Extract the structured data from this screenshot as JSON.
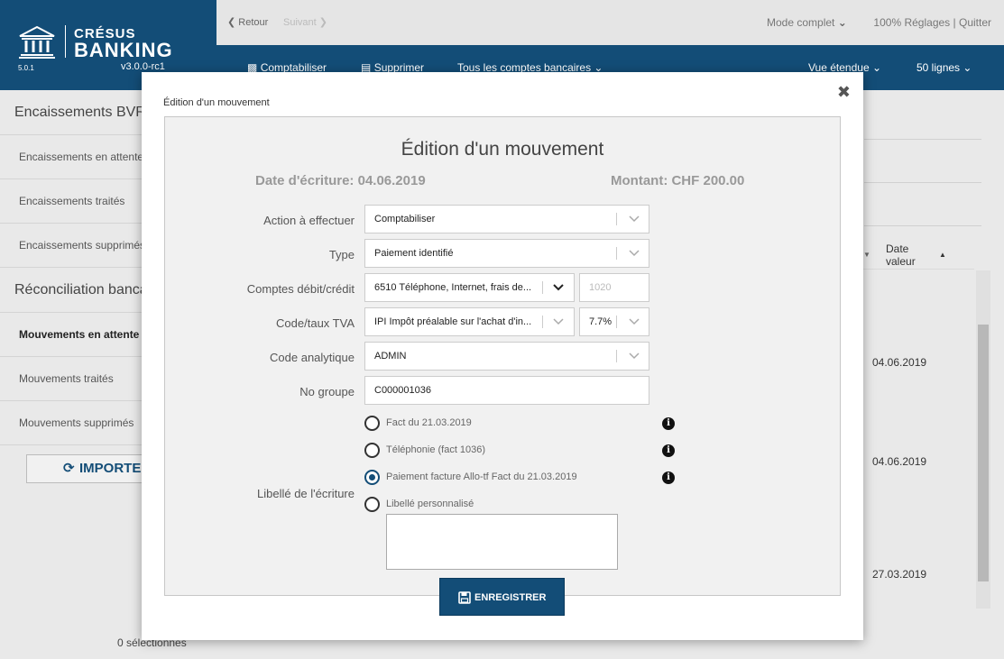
{
  "app": {
    "brand_top": "CRÉSUS",
    "brand_main": "BANKING",
    "version_small": "5.0.1",
    "version": "v3.0.0-rc1"
  },
  "topbar": {
    "back_label": "Retour",
    "next_label": "Suivant",
    "mode_label": "Mode complet",
    "zoom_label": "100%",
    "settings_label": "Réglages",
    "link_sep": "|",
    "quit_label": "Quitter"
  },
  "toolbar": {
    "post_label": "Comptabiliser",
    "delete_label": "Supprimer",
    "accounts_label": "Tous les comptes bancaires",
    "view_label": "Vue étendue",
    "lines_label": "50 lignes"
  },
  "sidebar": {
    "section_bvr": "Encaissements BVR",
    "bvr_items": [
      "Encaissements en attente",
      "Encaissements traités",
      "Encaissements supprimés"
    ],
    "section_reco": "Réconciliation bancaire",
    "reco_items": [
      "Mouvements en attente",
      "Mouvements traités",
      "Mouvements supprimés"
    ],
    "import_label": "IMPORTER",
    "selected_count": "0 sélectionnés"
  },
  "table": {
    "col_date_value": "Date valeur",
    "sort_up": "▲",
    "sort_down": "▼",
    "dates": [
      "04.06.2019",
      "04.06.2019",
      "27.03.2019"
    ]
  },
  "dialog": {
    "window_title": "Édition d'un mouvement",
    "close_symbol": "✖",
    "heading": "Édition d'un mouvement",
    "date_info": "Date d'écriture: 04.06.2019",
    "amount_info": "Montant: CHF 200.00",
    "fields": {
      "action_label": "Action à effectuer",
      "action_value": "Comptabiliser",
      "type_label": "Type",
      "type_value": "Paiement identifié",
      "accounts_label": "Comptes débit/crédit",
      "debit_value": "6510 Téléphone, Internet, frais de...",
      "credit_value": "1020",
      "vat_label": "Code/taux TVA",
      "vat_code_value": "IPI Impôt préalable sur l'achat d'in...",
      "vat_rate_value": "7.7%",
      "analytic_label": "Code analytique",
      "analytic_value": "ADMIN",
      "group_label": "No groupe",
      "group_value": "C000001036",
      "wording_label": "Libellé de l'écriture"
    },
    "wording_options": [
      {
        "label": "Fact du 21.03.2019",
        "checked": false,
        "info": true
      },
      {
        "label": "Téléphonie (fact 1036)",
        "checked": false,
        "info": true
      },
      {
        "label": "Paiement facture Allo-tf Fact du 21.03.2019",
        "checked": true,
        "info": true
      },
      {
        "label": "Libellé personnalisé",
        "checked": false,
        "info": false
      }
    ],
    "info_symbol": "i",
    "custom_text": "",
    "save_label": "ENREGISTRER"
  },
  "colors": {
    "brand": "#134d77",
    "panel_bg": "#f1f1f1",
    "muted_text": "#999999"
  }
}
